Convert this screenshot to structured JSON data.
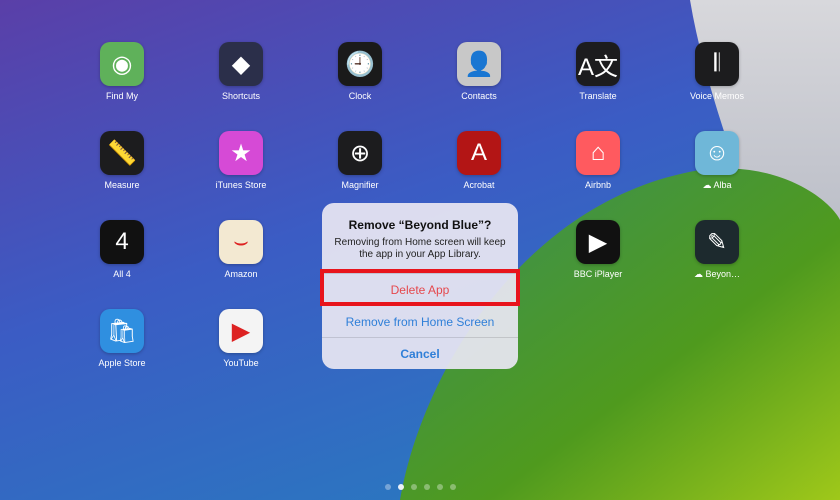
{
  "apps": [
    {
      "label": "Find My",
      "icon": "find-my-icon",
      "glyph": "◉",
      "bg": "#5fb15a"
    },
    {
      "label": "Shortcuts",
      "icon": "shortcuts-icon",
      "glyph": "◆",
      "bg": "#2b2f4a"
    },
    {
      "label": "Clock",
      "icon": "clock-icon",
      "glyph": "🕘",
      "bg": "#1a1a1a"
    },
    {
      "label": "Contacts",
      "icon": "contacts-icon",
      "glyph": "👤",
      "bg": "#c8c8c8"
    },
    {
      "label": "Translate",
      "icon": "translate-icon",
      "glyph": "A文",
      "bg": "#1c1c1e"
    },
    {
      "label": "Voice Memos",
      "icon": "voice-memos-icon",
      "glyph": "𝄃",
      "bg": "#1c1c1e"
    },
    {
      "label": "Measure",
      "icon": "measure-icon",
      "glyph": "📏",
      "bg": "#1c1c1e"
    },
    {
      "label": "iTunes Store",
      "icon": "itunes-store-icon",
      "glyph": "★",
      "bg": "#d64ad6"
    },
    {
      "label": "Magnifier",
      "icon": "magnifier-icon",
      "glyph": "⊕",
      "bg": "#1c1c1e"
    },
    {
      "label": "Acrobat",
      "icon": "acrobat-icon",
      "glyph": "A",
      "bg": "#b31515"
    },
    {
      "label": "Airbnb",
      "icon": "airbnb-icon",
      "glyph": "⌂",
      "bg": "#ff5a5f"
    },
    {
      "label": "Alba",
      "icon": "alba-icon",
      "glyph": "☺",
      "bg": "#6fb7d8",
      "cloud": true
    },
    {
      "label": "All 4",
      "icon": "all4-icon",
      "glyph": "4",
      "bg": "#111"
    },
    {
      "label": "Amazon",
      "icon": "amazon-icon",
      "glyph": "⌣",
      "bg": "#f3e9d2"
    },
    {
      "label": "BBC iPlayer",
      "icon": "bbc-iplayer-icon",
      "glyph": "▶",
      "bg": "#111"
    },
    {
      "label": "Beyon…",
      "icon": "beyond-blue-icon",
      "glyph": "✎",
      "bg": "#1d2a2e",
      "cloud": true
    },
    {
      "label": "Apple Store",
      "icon": "apple-store-icon",
      "glyph": "🛍",
      "bg": "#2f8fe0"
    },
    {
      "label": "YouTube",
      "icon": "youtube-icon",
      "glyph": "▶",
      "bg": "#f4f4f4"
    }
  ],
  "dialog": {
    "title": "Remove “Beyond Blue”?",
    "message": "Removing from Home screen will keep the app in your App Library.",
    "delete": "Delete App",
    "remove": "Remove from Home Screen",
    "cancel": "Cancel"
  },
  "colors": {
    "destructive": "#e5484d",
    "action": "#2f7fd8",
    "highlight": "#e8141c"
  },
  "page_dots": {
    "count": 6,
    "active": 2
  }
}
